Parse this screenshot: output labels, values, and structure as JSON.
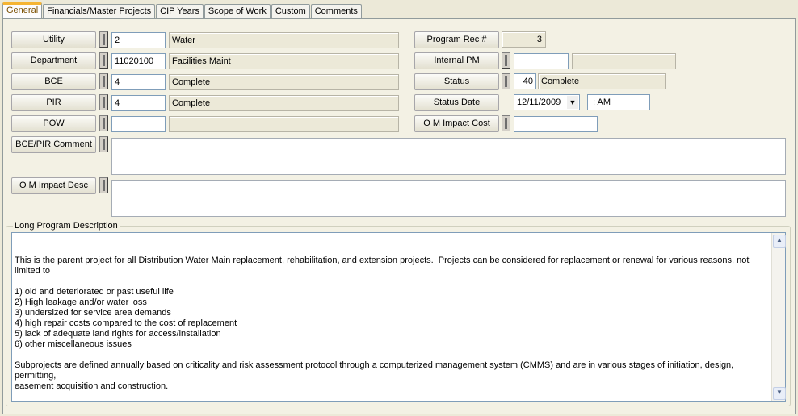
{
  "tabs": [
    {
      "label": "General"
    },
    {
      "label": "Financials/Master Projects"
    },
    {
      "label": "CIP Years"
    },
    {
      "label": "Scope of Work"
    },
    {
      "label": "Custom"
    },
    {
      "label": "Comments"
    }
  ],
  "left": {
    "utility": {
      "label": "Utility",
      "code": "2",
      "desc": "Water"
    },
    "department": {
      "label": "Department",
      "code": "11020100",
      "desc": "Facilities Maint"
    },
    "bce": {
      "label": "BCE",
      "code": "4",
      "desc": "Complete"
    },
    "pir": {
      "label": "PIR",
      "code": "4",
      "desc": "Complete"
    },
    "pow": {
      "label": "POW",
      "code": "",
      "desc": ""
    },
    "bce_pir_comment": {
      "label": "BCE/PIR Comment",
      "value": ""
    },
    "om_impact_desc": {
      "label": "O M Impact Desc",
      "value": ""
    }
  },
  "right": {
    "program_rec": {
      "label": "Program Rec #",
      "value": "3"
    },
    "internal_pm": {
      "label": "Internal PM",
      "code": "",
      "desc": ""
    },
    "status": {
      "label": "Status",
      "code": "40",
      "desc": "Complete"
    },
    "status_date": {
      "label": "Status Date",
      "date": "12/11/2009",
      "time": ":  AM"
    },
    "om_impact_cost": {
      "label": "O M Impact Cost",
      "value": ""
    }
  },
  "long_description": {
    "group_label": "Long Program Description",
    "text": "This is the parent project for all Distribution Water Main replacement, rehabilitation, and extension projects.  Projects can be considered for replacement or renewal for various reasons, not limited to\n\n1) old and deteriorated or past useful life\n2) High leakage and/or water loss\n3) undersized for service area demands\n4) high repair costs compared to the cost of replacement\n5) lack of adequate land rights for access/installation\n6) other miscellaneous issues\n\nSubprojects are defined annually based on criticality and risk assessment protocol through a computerized management system (CMMS) and are in various stages of initiation, design, permitting,\neasement acquisition and construction."
  },
  "icons": {
    "dropdown": "chevron-down-icon",
    "scroll_up": "scroll-up-arrow-icon",
    "scroll_down": "scroll-down-arrow-icon"
  }
}
